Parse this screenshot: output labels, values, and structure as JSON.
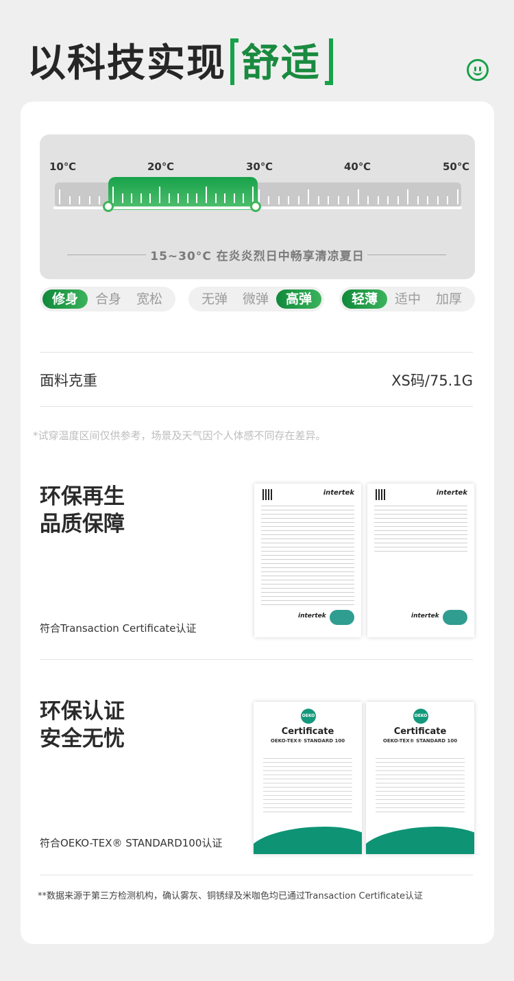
{
  "header": {
    "title_main": "以科技实现",
    "title_accent": "舒适"
  },
  "temperature": {
    "labels": [
      "10℃",
      "20℃",
      "30℃",
      "40℃",
      "50℃"
    ],
    "range_min": 15,
    "range_max": 30,
    "caption": "15~30°C 在炎炎烈日中畅享清凉夏日"
  },
  "fit_groups": [
    {
      "options": [
        "修身",
        "合身",
        "宽松"
      ],
      "selected": "修身"
    },
    {
      "options": [
        "无弹",
        "微弹",
        "高弹"
      ],
      "selected": "高弹"
    },
    {
      "options": [
        "轻薄",
        "适中",
        "加厚"
      ],
      "selected": "轻薄"
    }
  ],
  "fabric": {
    "label": "面料克重",
    "value": "XS码/75.1G"
  },
  "note": "*试穿温度区间仅供参考，场景及天气因个人体感不同存在差异。",
  "section1": {
    "title_line1": "环保再生",
    "title_line2": "品质保障",
    "subtitle": "符合Transaction Certificate认证",
    "doc_brand": "intertek"
  },
  "section2": {
    "title_line1": "环保认证",
    "title_line2": "安全无忧",
    "subtitle": "符合OEKO-TEX® STANDARD100认证",
    "cert_title": "Certificate",
    "cert_standard": "OEKO-TEX® STANDARD 100",
    "badge": "OEKO TEX"
  },
  "disclaimer": "**数据来源于第三方检测机构，确认雾灰、铜锈绿及米咖色均已通过Transaction Certificate认证"
}
